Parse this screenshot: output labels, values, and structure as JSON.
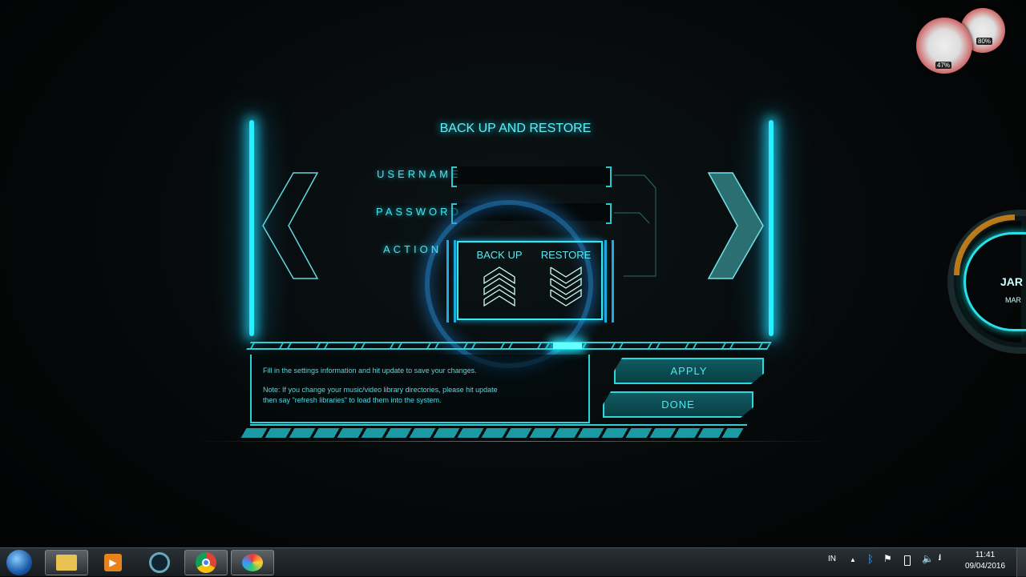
{
  "panel": {
    "title": "BACK UP AND RESTORE",
    "username_label": "USERNAME",
    "username_value": "",
    "password_label": "PASSWORD",
    "password_value": "",
    "action_label": "ACTION",
    "backup_label": "BACK UP",
    "restore_label": "RESTORE",
    "message_line1": "Fill in the settings information and hit update to save your changes.",
    "message_line2": "Note: If you change your music/video library directories, please hit update",
    "message_line3": "then say \"refresh libraries\" to load them into the system.",
    "apply_label": "APPLY",
    "done_label": "DONE",
    "accent": "#2ef0ff"
  },
  "gadgets": {
    "cpu_percent": "47%",
    "memory_percent": "80%",
    "jarvis_clip_text": "JAR",
    "jarvis_clip_sub": "MAR"
  },
  "taskbar": {
    "items": [
      "start-orb",
      "windows-explorer",
      "media-player",
      "jarvis-app",
      "google-chrome",
      "paint"
    ],
    "language": "IN",
    "time": "11:41",
    "date": "09/04/2016"
  }
}
